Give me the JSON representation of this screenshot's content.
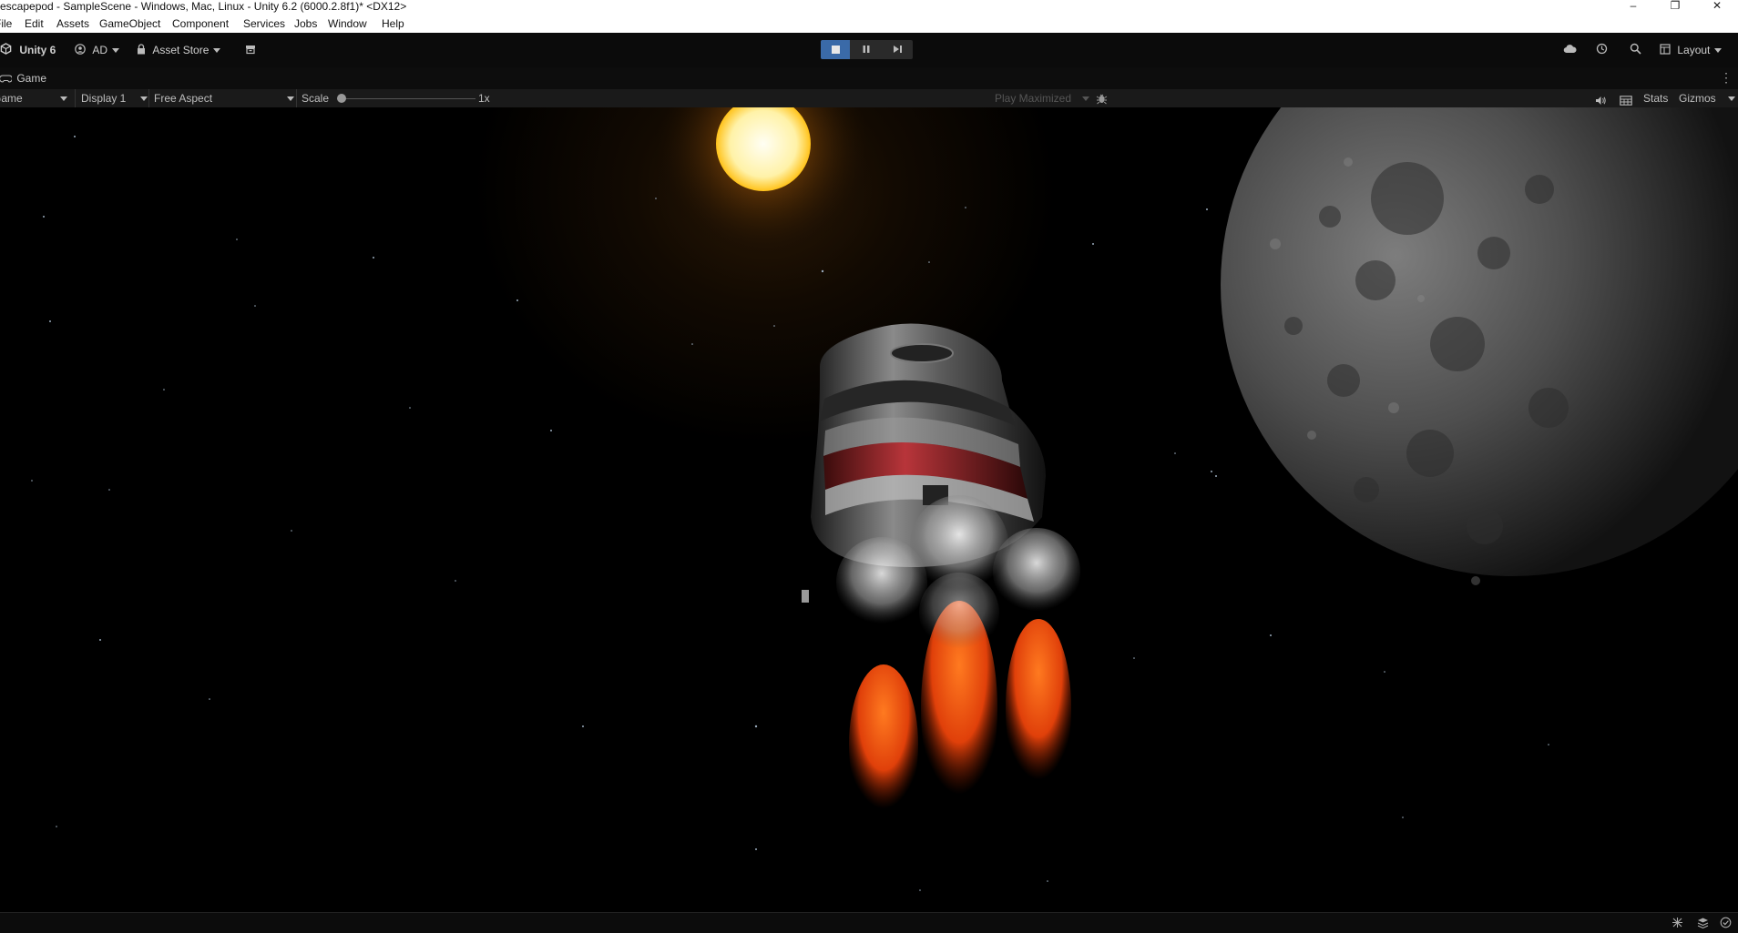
{
  "window": {
    "title": "escapepod - SampleScene - Windows, Mac, Linux - Unity 6.2 (6000.2.8f1)* <DX12>",
    "minimize_glyph": "–",
    "maximize_glyph": "❐",
    "close_glyph": "✕"
  },
  "menu": [
    "File",
    "Edit",
    "Assets",
    "GameObject",
    "Component",
    "Services",
    "Jobs",
    "Window",
    "Help"
  ],
  "toolbar": {
    "unity_label": "Unity 6",
    "account_label": "AD",
    "asset_store_label": "Asset Store",
    "layout_label": "Layout",
    "play_mode_active": true
  },
  "tab": {
    "label": "Game"
  },
  "game_toolbar": {
    "mode_label": "Game",
    "display_label": "Display 1",
    "aspect_label": "Free Aspect",
    "scale_label": "Scale",
    "scale_value": "1x",
    "play_maximized_label": "Play Maximized",
    "stats_label": "Stats",
    "gizmos_label": "Gizmos"
  },
  "colors": {
    "play_active": "#3a6aa8",
    "sun": "#ffd23a",
    "flame": "#ff5a0a"
  },
  "icons": [
    "unity-logo-icon",
    "account-icon",
    "lock-icon",
    "package-icon",
    "stop-icon",
    "pause-icon",
    "step-icon",
    "cloud-icon",
    "history-icon",
    "search-icon",
    "layout-icon",
    "game-controller-icon",
    "kebab-menu-icon",
    "bug-icon",
    "audio-icon",
    "grid-icon",
    "network-icon",
    "layers-icon",
    "check-circle-icon"
  ]
}
